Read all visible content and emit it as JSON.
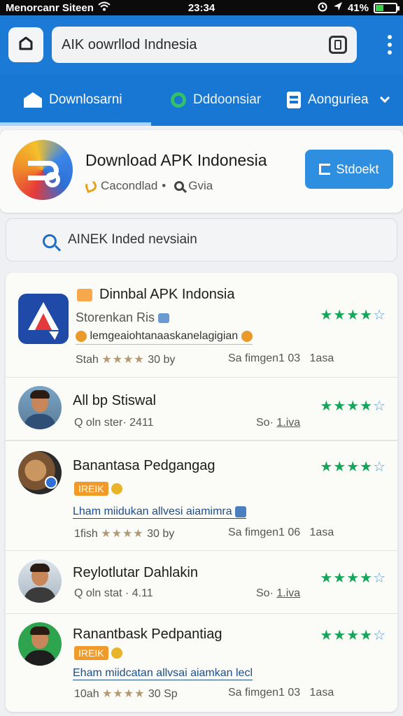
{
  "status": {
    "carrier": "Menorcanr Siteen",
    "time": "23:34",
    "battery": "41%",
    "battery_level": 0.41
  },
  "topbar": {
    "url": "AIK oowrllod Indnesia"
  },
  "nav": {
    "tabs": [
      {
        "label": "Downlosarni",
        "icon": "home-icon",
        "active": true
      },
      {
        "label": "Dddoonsiar",
        "icon": "chat-icon"
      },
      {
        "label": "Aonguriea",
        "icon": "document-icon"
      }
    ]
  },
  "header": {
    "title": "Download APK Indonesia",
    "meta_left": "Cacondlad",
    "meta_sep": "•",
    "meta_right": "Gvia",
    "button_label": "Stdoekt"
  },
  "search": {
    "text": "AINEK Inded nevsiain"
  },
  "list": [
    {
      "title": "Dinnbal APK Indonsia",
      "subtitle": "Storenkan Ris",
      "description": "lemgeaiohtanaaskanelagigian",
      "stats_left": "Stah",
      "stats_left_tail": "30 by",
      "stats_right": "Sa fimgen1 03",
      "stats_right_tail": "1asa",
      "rating": 4
    },
    {
      "title": "All bp Stiswal",
      "meta_left": "Q oln ster· 2411",
      "meta_right": "So·",
      "meta_right_tail": "1.iva",
      "rating": 4
    },
    {
      "title": "Banantasa Pedgangag",
      "badge": "IREIK",
      "description": "Lham miidukan allvesi aiamimra",
      "stats_left": "1fish",
      "stats_left_tail": "30 by",
      "stats_right": "Sa fimgen1 06",
      "stats_right_tail": "1asa",
      "rating": 4
    },
    {
      "title": "Reylotlutar Dahlakin",
      "meta_left": "Q oln stat · 4.11",
      "meta_right": "So·",
      "meta_right_tail": "1.iva",
      "rating": 4
    },
    {
      "title": "Ranantbask Pedpantiag",
      "badge": "IREIK",
      "description": "Eham miidcatan allvsai aiamkan lecl",
      "stats_left": "10ah",
      "stats_left_tail": "30 Sp",
      "stats_right": "Sa fimgen1 03",
      "stats_right_tail": "1asa",
      "rating": 4
    }
  ],
  "colors": {
    "appbar": "#1a7ad6",
    "tabs": "#1877d2",
    "accent_button": "#2e8fe0",
    "star_green": "#16a65a"
  }
}
